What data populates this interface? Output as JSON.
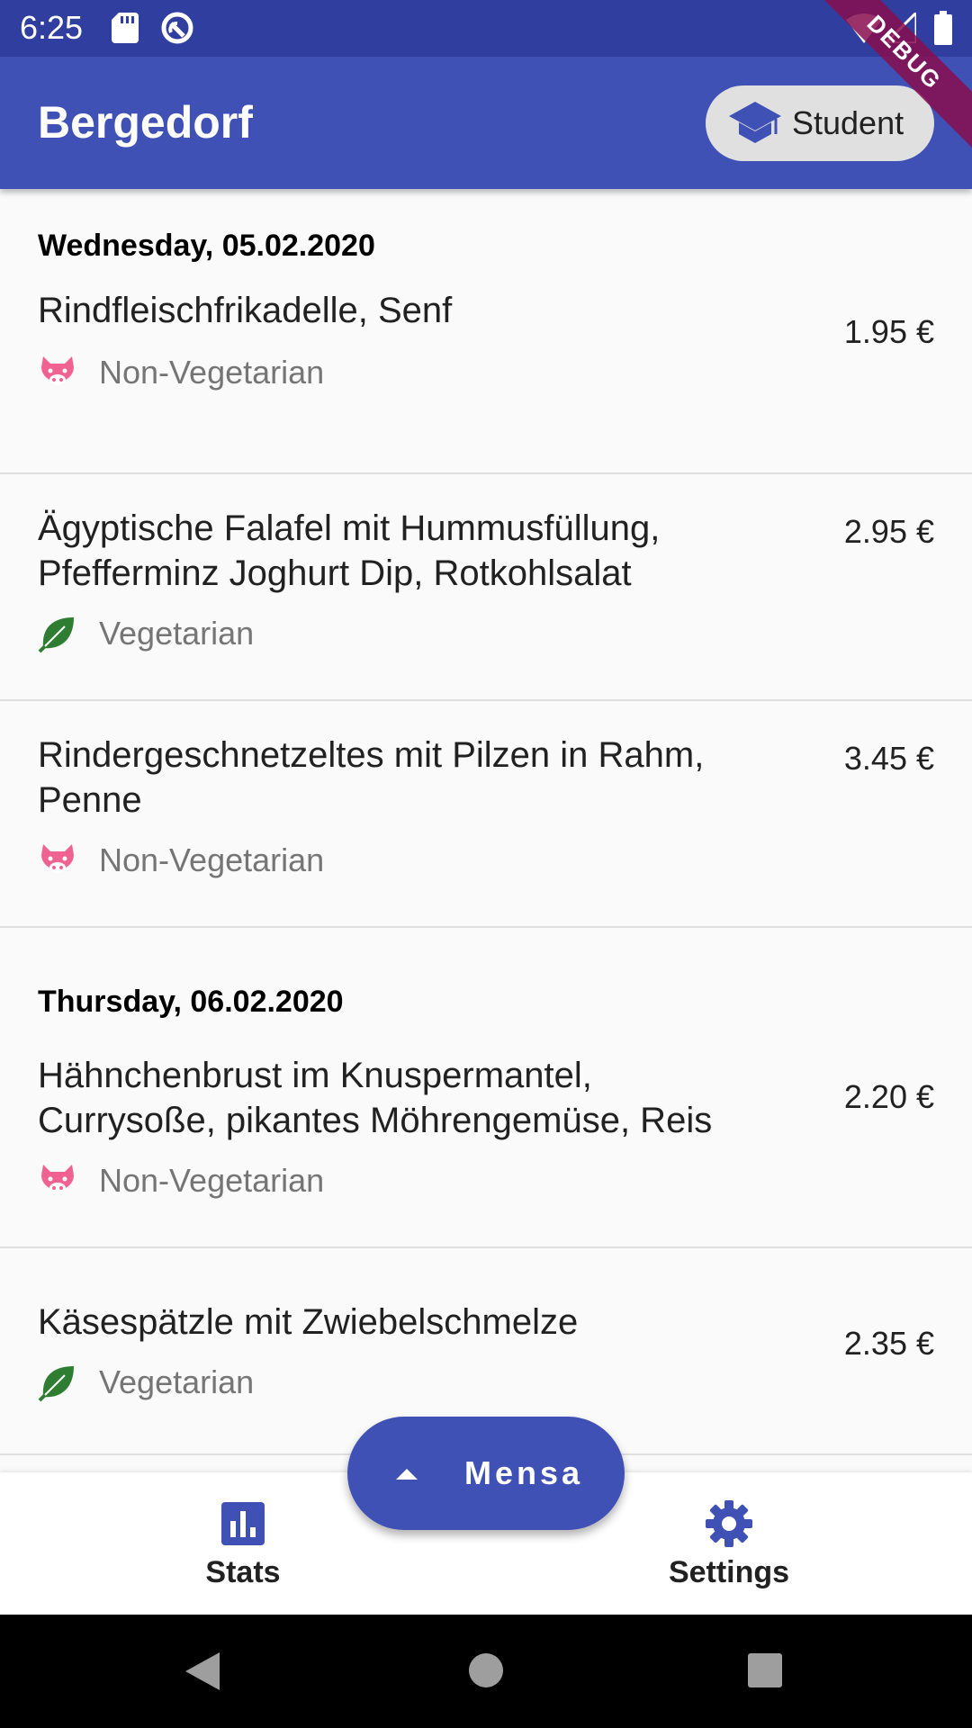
{
  "status_bar": {
    "time": "6:25",
    "icons": [
      "sd-card-icon",
      "sync-icon",
      "wifi-icon",
      "signal-icon",
      "battery-icon"
    ]
  },
  "app_bar": {
    "title": "Bergedorf",
    "chip_label": "Student",
    "chip_icon": "graduation-cap-icon",
    "color": "#3f51b5"
  },
  "debug_banner": "DEBUG",
  "days": [
    {
      "label": "Wednesday, 05.02.2020",
      "meals": [
        {
          "name": "Rindfleischfrikadelle, Senf",
          "price": "1.95 €",
          "tag": "Non-Vegetarian",
          "icon": "pig-icon"
        },
        {
          "name": "Ägyptische Falafel mit Hummusfüllung, Pfefferminz Joghurt Dip, Rotkohlsalat",
          "price": "2.95 €",
          "tag": "Vegetarian",
          "icon": "leaf-icon"
        },
        {
          "name": "Rindergeschnetzeltes mit Pilzen in Rahm, Penne",
          "price": "3.45 €",
          "tag": "Non-Vegetarian",
          "icon": "pig-icon"
        }
      ]
    },
    {
      "label": "Thursday, 06.02.2020",
      "meals": [
        {
          "name": "Hähnchenbrust im Knuspermantel, Currysoße, pikantes Möhrengemüse, Reis",
          "price": "2.20 €",
          "tag": "Non-Vegetarian",
          "icon": "pig-icon"
        },
        {
          "name": "Käsespätzle mit Zwiebelschmelze",
          "price": "2.35 €",
          "tag": "Vegetarian",
          "icon": "leaf-icon"
        }
      ]
    }
  ],
  "fab": {
    "label": "Mensa",
    "icon": "arrow-up-icon"
  },
  "bottom_nav": {
    "stats_label": "Stats",
    "settings_label": "Settings"
  },
  "colors": {
    "primary": "#3f51b5",
    "primary_dark": "#303f9f",
    "pig": "#f06292",
    "leaf": "#2e7d32"
  }
}
